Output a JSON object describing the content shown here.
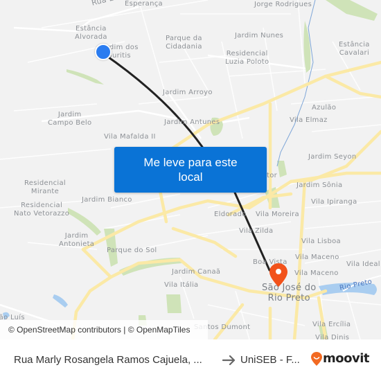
{
  "map": {
    "labels": [
      {
        "text": "Rua E",
        "id": "street-rua-e"
      },
      {
        "text": "Esperança",
        "id": "esperanca"
      },
      {
        "text": "Jorge Rodrigues",
        "id": "jorge-rodrigues"
      },
      {
        "text": "Estância\nAlvorada",
        "id": "estancia-alvorada"
      },
      {
        "text": "Jardim dos\nBuritis",
        "id": "jardim-dos-buritis"
      },
      {
        "text": "Parque da\nCidadania",
        "id": "parque-da-cidadania"
      },
      {
        "text": "Jardim Nunes",
        "id": "jardim-nunes"
      },
      {
        "text": "Residencial\nLuzia Poloto",
        "id": "residencial-luzia-poloto"
      },
      {
        "text": "Estância\nCavalari",
        "id": "estancia-cavalari"
      },
      {
        "text": "Jardim Arroyo",
        "id": "jardim-arroyo"
      },
      {
        "text": "Azulão",
        "id": "azulao"
      },
      {
        "text": "Jardim\nCampo Belo",
        "id": "jardim-campo-belo"
      },
      {
        "text": "Jardim Antunes",
        "id": "jardim-antunes"
      },
      {
        "text": "Vila Elmaz",
        "id": "vila-elmaz"
      },
      {
        "text": "Vila Mafalda II",
        "id": "vila-mafalda-ii"
      },
      {
        "text": "Jardim Seyon",
        "id": "jardim-seyon"
      },
      {
        "text": "Residencial\nMirante",
        "id": "residencial-mirante"
      },
      {
        "text": "Jardim Sônia",
        "id": "jardim-sonia"
      },
      {
        "text": "Redentor",
        "id": "redentor"
      },
      {
        "text": "Jardim Bianco",
        "id": "jardim-bianco"
      },
      {
        "text": "Residencial\nNato Vetorazzo",
        "id": "residencial-nato-vetorazzo"
      },
      {
        "text": "Eldorado",
        "id": "eldorado"
      },
      {
        "text": "Vila Moreira",
        "id": "vila-moreira"
      },
      {
        "text": "Vila Ipiranga",
        "id": "vila-ipiranga"
      },
      {
        "text": "Jardim\nAntonieta",
        "id": "jardim-antonieta"
      },
      {
        "text": "Vila Zilda",
        "id": "vila-zilda"
      },
      {
        "text": "Vila Lisboa",
        "id": "vila-lisboa"
      },
      {
        "text": "Parque do Sol",
        "id": "parque-do-sol"
      },
      {
        "text": "Vila Maceno",
        "id": "vila-maceno-1"
      },
      {
        "text": "Boa Vista",
        "id": "boa-vista"
      },
      {
        "text": "Vila Ideal",
        "id": "vila-ideal"
      },
      {
        "text": "Jardim Canaã",
        "id": "jardim-canaa"
      },
      {
        "text": "Vila Maceno",
        "id": "vila-maceno-2"
      },
      {
        "text": "Vila Itália",
        "id": "vila-italia"
      },
      {
        "text": "São José do\nRio Preto",
        "id": "sao-jose-do-rio-preto"
      },
      {
        "text": "Rio Preto",
        "id": "river-rio-preto"
      },
      {
        "text": "São Luís",
        "id": "sao-luis"
      },
      {
        "text": "Santos Dumont",
        "id": "santos-dumont"
      },
      {
        "text": "Vila Ercília",
        "id": "vila-ercilia"
      },
      {
        "text": "Vila Dinis",
        "id": "vila-dinis"
      }
    ],
    "cta_label": "Me leve para este local",
    "attribution": "© OpenStreetMap contributors | © OpenMapTiles",
    "colors": {
      "background": "#f2f2f2",
      "major_road": "#fbe9a6",
      "park": "#cfe3b8",
      "water": "#a9cdf0",
      "route_line": "#222222",
      "origin_marker": "#2b7cf0",
      "destination_marker": "#f2521b",
      "cta_button": "#0a73d6"
    },
    "origin_icon": "origin-dot-icon",
    "destination_icon": "map-pin-icon"
  },
  "footer": {
    "from": "Rua Marly Rosangela Ramos Cajuela, ...",
    "arrow_icon": "arrow-right-icon",
    "to": "UniSEB - F...",
    "brand": "moovit",
    "brand_color": "#f26a22"
  }
}
